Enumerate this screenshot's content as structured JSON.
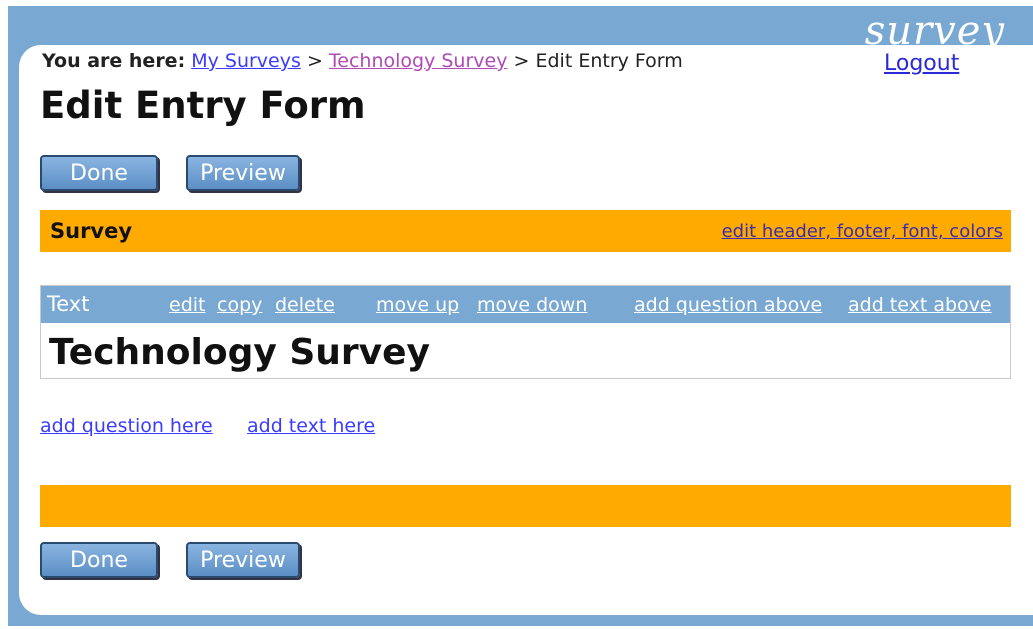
{
  "brand": "survey",
  "breadcrumb": {
    "prefix": "You are here:",
    "items": [
      "My Surveys",
      "Technology Survey"
    ],
    "separator": ">",
    "current": "Edit Entry Form"
  },
  "logout": "Logout",
  "page_title": "Edit Entry Form",
  "buttons": {
    "done": "Done",
    "preview": "Preview"
  },
  "survey_bar": {
    "label": "Survey",
    "edit_link": "edit header, footer, font, colors"
  },
  "text_block": {
    "type_label": "Text",
    "actions": {
      "edit": "edit",
      "copy": "copy",
      "delete": "delete",
      "move_up": "move up",
      "move_down": "move down",
      "add_question_above": "add question above",
      "add_text_above": "add text above"
    },
    "content": "Technology Survey"
  },
  "add_links": {
    "add_question_here": "add question here",
    "add_text_here": "add text here"
  },
  "colors": {
    "frame_blue": "#79a8d3",
    "orange": "#ffaa00",
    "link_blue": "#3b3bff"
  }
}
